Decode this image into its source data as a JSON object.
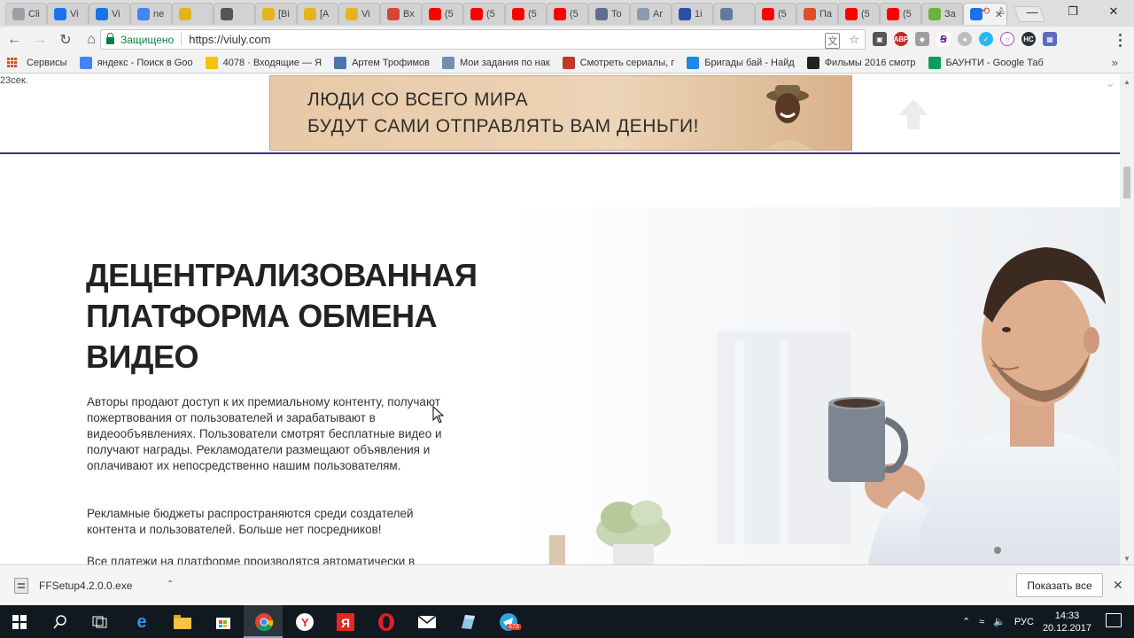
{
  "browser": {
    "tabs": [
      {
        "label": "Cli",
        "color": "#9aa0a6",
        "icon": "generic-site-icon"
      },
      {
        "label": "Vi",
        "color": "#1a73e8",
        "icon": "viuly-icon"
      },
      {
        "label": "Vi",
        "color": "#1a73e8",
        "icon": "viuly-icon"
      },
      {
        "label": "ne",
        "color": "#4285f4",
        "icon": "google-icon"
      },
      {
        "label": "",
        "color": "#e5b31d",
        "icon": "coin-icon"
      },
      {
        "label": "",
        "color": "#555555",
        "icon": "lightning-icon"
      },
      {
        "label": "[Bi",
        "color": "#e5b31d",
        "icon": "coin-icon"
      },
      {
        "label": "[A",
        "color": "#e5b31d",
        "icon": "coin-icon"
      },
      {
        "label": "Vi",
        "color": "#e5b31d",
        "icon": "coin-icon"
      },
      {
        "label": "Вх",
        "color": "#d44638",
        "icon": "gmail-icon"
      },
      {
        "label": "(5",
        "color": "#ff0000",
        "icon": "youtube-icon"
      },
      {
        "label": "(5",
        "color": "#ff0000",
        "icon": "youtube-icon"
      },
      {
        "label": "(5",
        "color": "#ff0000",
        "icon": "youtube-icon"
      },
      {
        "label": "(5",
        "color": "#ff0000",
        "icon": "youtube-icon"
      },
      {
        "label": "To",
        "color": "#5f6f8f",
        "icon": "generic-site-icon"
      },
      {
        "label": "Ar",
        "color": "#8e9aaf",
        "icon": "generic-site-icon"
      },
      {
        "label": "1i",
        "color": "#2b4fa8",
        "icon": "link-icon"
      },
      {
        "label": "",
        "color": "#5f7c9f",
        "icon": "play-icon"
      },
      {
        "label": "(5",
        "color": "#ff0000",
        "icon": "youtube-icon"
      },
      {
        "label": "Па",
        "color": "#e44d26",
        "icon": "generic-site-icon"
      },
      {
        "label": "(5",
        "color": "#ff0000",
        "icon": "youtube-icon"
      },
      {
        "label": "(5",
        "color": "#ff0000",
        "icon": "youtube-icon"
      },
      {
        "label": "За",
        "color": "#6bb33b",
        "icon": "generic-site-icon"
      },
      {
        "label": "",
        "color": "#1a73e8",
        "icon": "viuly-icon",
        "active": true
      }
    ],
    "security_label": "Защищено",
    "url": "https://viuly.com",
    "bookmarks": [
      {
        "label": "Сервисы",
        "color": "#e04a2e",
        "icon": "apps-icon"
      },
      {
        "label": "яндекс - Поиск в Goo",
        "color": "#4285f4",
        "icon": "google-icon"
      },
      {
        "label": "4078 · Входящие — Я",
        "color": "#f4c20d",
        "icon": "mail-icon"
      },
      {
        "label": "Артем Трофимов",
        "color": "#4a76a8",
        "icon": "vk-icon"
      },
      {
        "label": "Мои задания по нак",
        "color": "#6f8fb0",
        "icon": "tasks-icon"
      },
      {
        "label": "Смотреть сериалы, г",
        "color": "#c0392b",
        "icon": "tv-icon"
      },
      {
        "label": "Бригады бай - Найд",
        "color": "#1e88e5",
        "icon": "brigade-icon"
      },
      {
        "label": "Фильмы 2016 смотр",
        "color": "#222222",
        "icon": "films-icon"
      },
      {
        "label": "БАУНТИ - Google Таб",
        "color": "#0f9d58",
        "icon": "sheets-icon"
      }
    ]
  },
  "page": {
    "timer": "23сек.",
    "banner_line1": "ЛЮДИ СО ВСЕГО МИРА",
    "banner_line2": "БУДУТ САМИ ОТПРАВЛЯТЬ ВАМ ДЕНЬГИ!",
    "hero_title_line1": "ДЕЦЕНТРАЛИЗОВАННАЯ",
    "hero_title_line2": "ПЛАТФОРМА ОБМЕНА",
    "hero_title_line3": "ВИДЕО",
    "paragraph1": "Авторы продают доступ к их премиальному контенту, получают пожертвования от пользователей и зарабатывают в видеообъявлениях. Пользователи смотрят бесплатные видео и получают награды. Рекламодатели размещают объявления и оплачивают их непосредственно нашим пользователям.",
    "paragraph2": "Рекламные бюджеты распространяются среди создателей контента и пользователей. Больше нет посредников!",
    "paragraph3": "Все платежи на платформе производятся автоматически в"
  },
  "downloads": {
    "file_name": "FFSetup4.2.0.0.exe",
    "show_all": "Показать все"
  },
  "taskbar": {
    "language": "РУС",
    "time": "14:33",
    "date": "20.12.2017",
    "telegram_badge": "673"
  }
}
